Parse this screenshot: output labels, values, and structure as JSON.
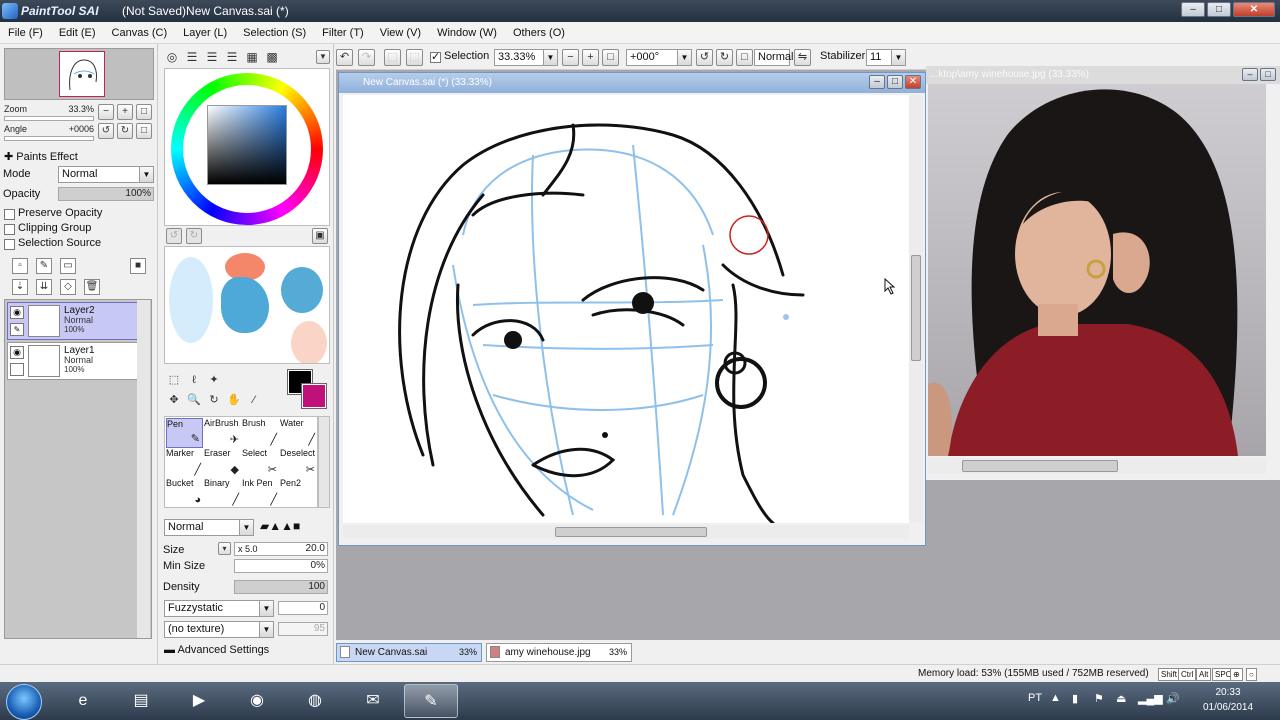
{
  "window": {
    "logo_text": "PaintTool SAI",
    "title": "(Not Saved)New Canvas.sai (*)",
    "min_symbol": "–",
    "max_symbol": "□",
    "close_symbol": "✕"
  },
  "menu": [
    "File (F)",
    "Edit (E)",
    "Canvas (C)",
    "Layer (L)",
    "Selection (S)",
    "Filter (T)",
    "View (V)",
    "Window (W)",
    "Others (O)"
  ],
  "navigator": {
    "zoom_label": "Zoom",
    "zoom_value": "33.3%",
    "angle_label": "Angle",
    "angle_value": "+0006"
  },
  "layer_panel": {
    "paints_effect": "Paints Effect",
    "mode_label": "Mode",
    "mode_value": "Normal",
    "opacity_label": "Opacity",
    "opacity_value": "100%",
    "preserve_opacity": "Preserve Opacity",
    "clipping_group": "Clipping Group",
    "selection_source": "Selection Source",
    "layers": [
      {
        "name": "Layer2",
        "mode": "Normal",
        "opacity": "100%",
        "selected": true
      },
      {
        "name": "Layer1",
        "mode": "Normal",
        "opacity": "100%",
        "selected": false
      }
    ]
  },
  "tools": {
    "brushes": [
      {
        "label": "Pen",
        "icon": "✎"
      },
      {
        "label": "AirBrush",
        "icon": "✈"
      },
      {
        "label": "Brush",
        "icon": "╱"
      },
      {
        "label": "Water",
        "icon": "╱"
      },
      {
        "label": "Marker",
        "icon": "╱"
      },
      {
        "label": "Eraser",
        "icon": "◆"
      },
      {
        "label": "Select",
        "icon": "✂"
      },
      {
        "label": "Deselect",
        "icon": "✂"
      },
      {
        "label": "Bucket",
        "icon": "◕"
      },
      {
        "label": "Binary",
        "icon": "╱"
      },
      {
        "label": "Ink Pen",
        "icon": "╱"
      },
      {
        "label": "Pen2",
        "icon": ""
      }
    ],
    "blend_mode": "Normal",
    "size_label": "Size",
    "size_mult": "x 5.0",
    "size_value": "20.0",
    "min_size_label": "Min Size",
    "min_size_value": "0%",
    "density_label": "Density",
    "density_value": "100",
    "shape_value": "Fuzzystatic",
    "shape_strength": "0",
    "texture_value": "(no texture)",
    "texture_strength": "95",
    "advanced": "Advanced Settings"
  },
  "toolbar": {
    "selection_label": "Selection",
    "zoom_value": "33.33%",
    "angle_value": "+000°",
    "mode_value": "Normal",
    "stabilizer_label": "Stabilizer",
    "stabilizer_value": "11"
  },
  "canvas": {
    "title": "New Canvas.sai (*) (33.33%)",
    "ref_title": "...ktop\\amy winehouse.jpg (33.33%)"
  },
  "doc_tabs": [
    {
      "name": "New Canvas.sai",
      "zoom": "33%",
      "active": true
    },
    {
      "name": "amy winehouse.jpg",
      "zoom": "33%",
      "active": false
    }
  ],
  "status": {
    "memory": "Memory load: 53% (155MB used / 752MB reserved)",
    "keys": [
      "Shift",
      "Ctrl",
      "Alt",
      "SPC",
      "⊕",
      "○"
    ]
  },
  "taskbar": {
    "apps": [
      {
        "name": "internet-explorer",
        "glyph": "e"
      },
      {
        "name": "file-explorer",
        "glyph": "▤"
      },
      {
        "name": "media-player",
        "glyph": "▶"
      },
      {
        "name": "chrome",
        "glyph": "◉"
      },
      {
        "name": "firefox",
        "glyph": "◍"
      },
      {
        "name": "outlook",
        "glyph": "✉"
      },
      {
        "name": "painttool-sai",
        "glyph": "✎"
      }
    ],
    "lang": "PT",
    "time": "20:33",
    "date": "01/06/2014"
  },
  "colors": {
    "foreground": "#000000",
    "background": "#c0107a",
    "selected_layer": "#c8c8f4"
  }
}
